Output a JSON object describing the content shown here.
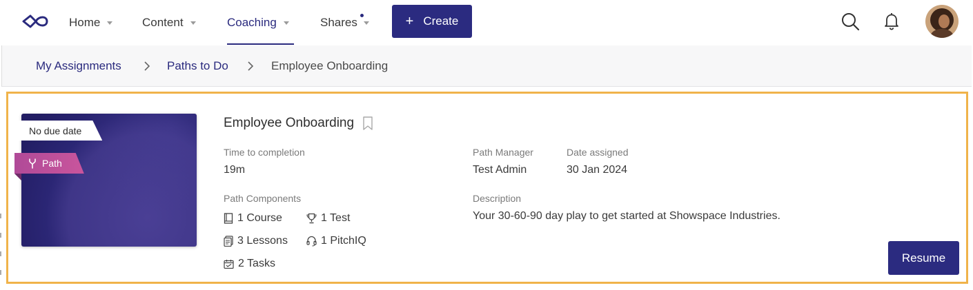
{
  "nav": {
    "items": [
      {
        "label": "Home"
      },
      {
        "label": "Content"
      },
      {
        "label": "Coaching"
      },
      {
        "label": "Shares"
      }
    ],
    "create_label": "Create",
    "icons": {
      "logo": "infinity-logo",
      "search": "search-icon",
      "bell": "bell-icon",
      "avatar": "user-avatar"
    },
    "accent_color": "#2b2b80"
  },
  "breadcrumb": {
    "items": [
      "My Assignments",
      "Paths to Do",
      "Employee Onboarding"
    ]
  },
  "card": {
    "due_tag": "No due date",
    "type_tag": "Path",
    "title": "Employee Onboarding",
    "time_label": "Time to completion",
    "time_value": "19m",
    "components_label": "Path Components",
    "components": [
      {
        "label": "1 Course",
        "icon": "book-icon"
      },
      {
        "label": "1 Test",
        "icon": "trophy-icon"
      },
      {
        "label": "3 Lessons",
        "icon": "lessons-icon"
      },
      {
        "label": "1 PitchIQ",
        "icon": "headset-icon"
      },
      {
        "label": "2 Tasks",
        "icon": "calendar-icon"
      }
    ],
    "manager_label": "Path Manager",
    "manager_value": "Test Admin",
    "date_label": "Date assigned",
    "date_value": "30 Jan 2024",
    "description_label": "Description",
    "description": "Your 30-60-90 day play to get started at Showspace Industries.",
    "resume_label": "Resume",
    "highlight_color": "#f0b34a"
  }
}
